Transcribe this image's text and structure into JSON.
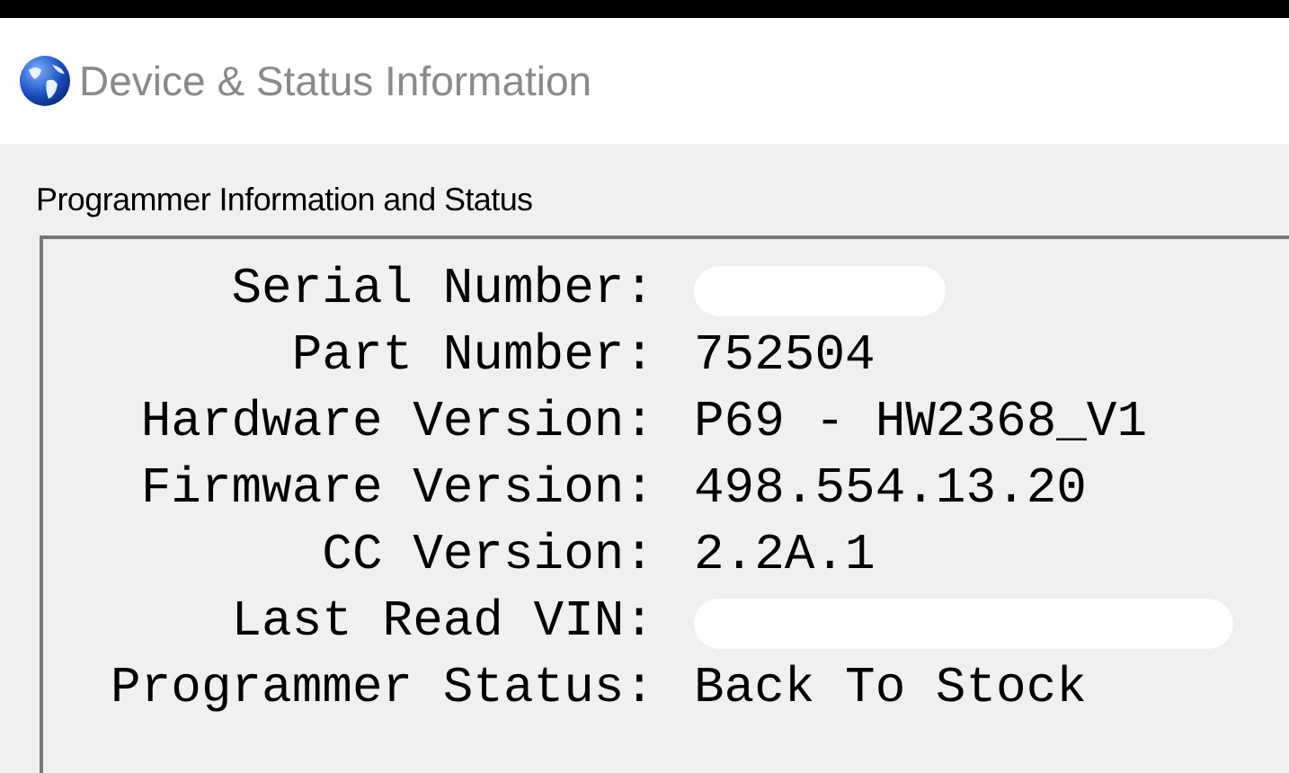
{
  "window": {
    "title": "Device & Status Information"
  },
  "group": {
    "title": "Programmer Information and Status"
  },
  "fields": [
    {
      "label": "Serial Number:",
      "redacted": true
    },
    {
      "label": "Part Number:",
      "value": "752504",
      "redacted": false
    },
    {
      "label": "Hardware Version:",
      "value": "P69 - HW2368_V1",
      "redacted": false
    },
    {
      "label": "Firmware Version:",
      "value": "498.554.13.20",
      "redacted": false
    },
    {
      "label": "CC Version:",
      "value": "2.2A.1",
      "redacted": false
    },
    {
      "label": "Last Read VIN:",
      "redacted": true,
      "wide": true
    },
    {
      "label": "Programmer Status:",
      "value": "Back To Stock",
      "redacted": false
    }
  ]
}
